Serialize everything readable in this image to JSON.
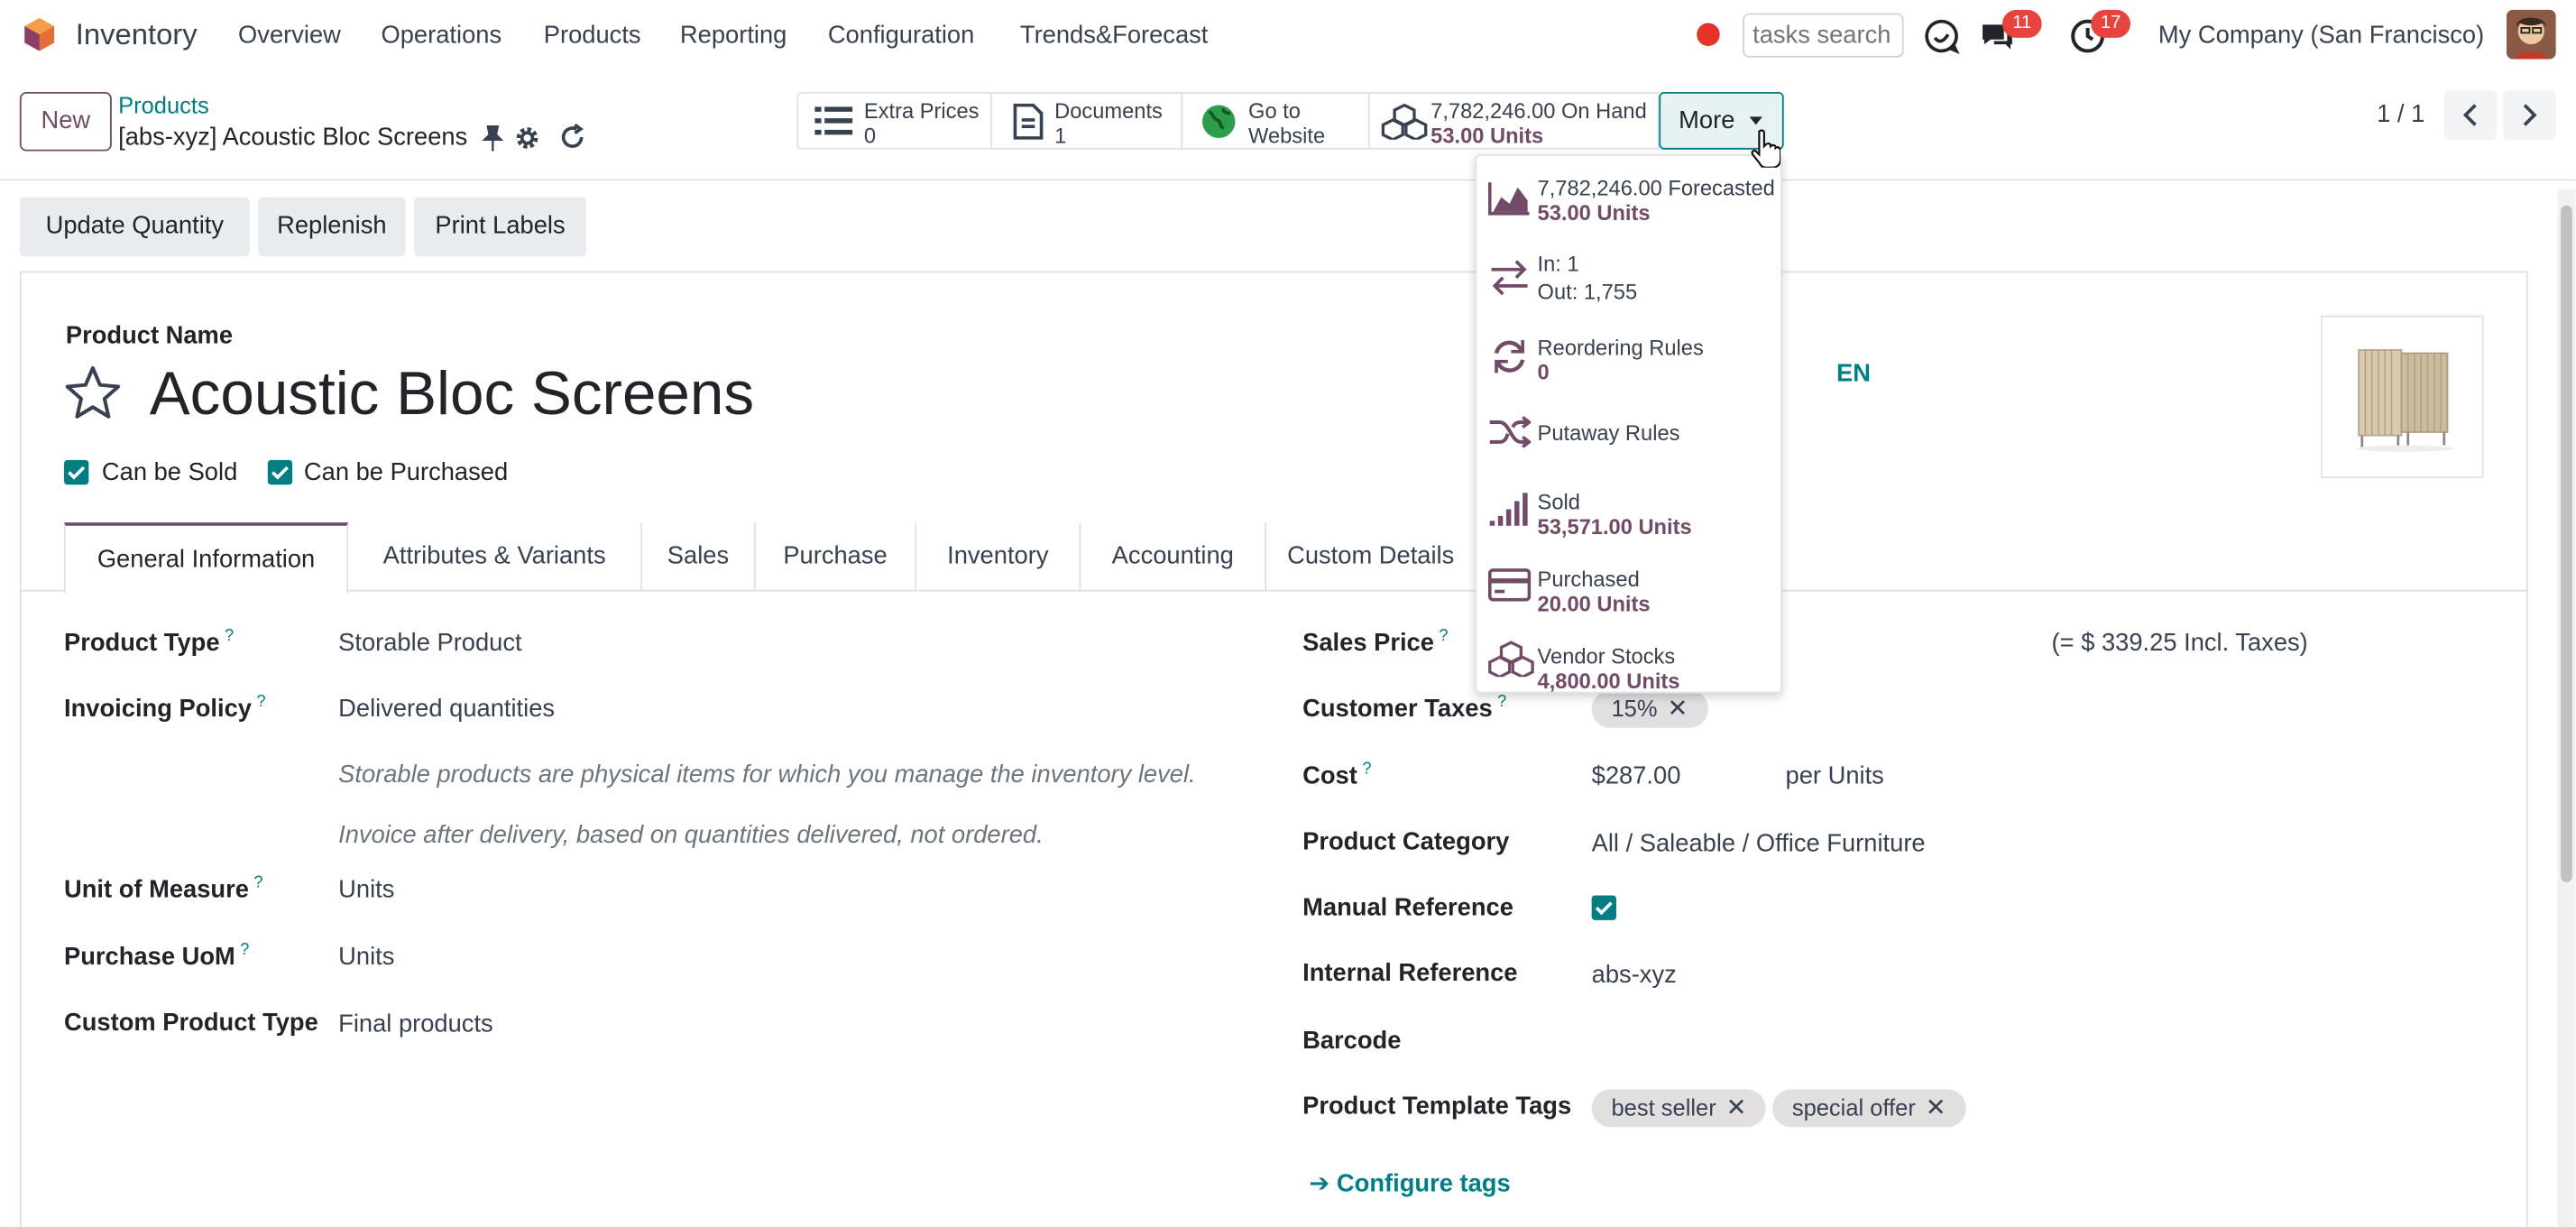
{
  "navbar": {
    "app_name": "Inventory",
    "menu": [
      "Overview",
      "Operations",
      "Products",
      "Reporting",
      "Configuration",
      "Trends&Forecast"
    ],
    "search_placeholder": "tasks search",
    "messages_count": "11",
    "activities_count": "17",
    "company": "My Company (San Francisco)"
  },
  "control": {
    "new_label": "New",
    "breadcrumb_parent": "Products",
    "breadcrumb_current": "[abs-xyz] Acoustic Bloc Screens",
    "smart_buttons": [
      {
        "icon": "list-icon",
        "line1": "Extra Prices",
        "line2": "0"
      },
      {
        "icon": "file-icon",
        "line1": "Documents",
        "line2": "1"
      },
      {
        "icon": "globe-icon",
        "line1": "Go to",
        "line2": "Website"
      },
      {
        "icon": "cubes-icon",
        "line1": "7,782,246.00 On Hand",
        "line2": "53.00 Units"
      }
    ],
    "more_label": "More",
    "pager": "1 / 1"
  },
  "dropdown": {
    "items": [
      {
        "icon": "area-chart-icon",
        "line1": "7,782,246.00 Forecasted",
        "line2": "53.00 Units"
      },
      {
        "icon": "exchange-icon",
        "line1": "In: 1",
        "line2": "Out: 1,755"
      },
      {
        "icon": "refresh-icon",
        "line1": "Reordering Rules",
        "line2": "0"
      },
      {
        "icon": "random-icon",
        "line1": "Putaway Rules",
        "line2": ""
      },
      {
        "icon": "signal-icon",
        "line1": "Sold",
        "line2": "53,571.00 Units"
      },
      {
        "icon": "credit-card-icon",
        "line1": "Purchased",
        "line2": "20.00 Units"
      },
      {
        "icon": "cubes-icon",
        "line1": "Vendor Stocks",
        "line2": "4,800.00 Units"
      }
    ]
  },
  "status_buttons": [
    "Update Quantity",
    "Replenish",
    "Print Labels"
  ],
  "product": {
    "name_label": "Product Name",
    "name": "Acoustic Bloc Screens",
    "lang": "EN",
    "can_be_sold": "Can be Sold",
    "can_be_purchased": "Can be Purchased"
  },
  "tabs": [
    "General Information",
    "Attributes & Variants",
    "Sales",
    "Purchase",
    "Inventory",
    "Accounting",
    "Custom Details"
  ],
  "left_fields": {
    "product_type_label": "Product Type",
    "product_type": "Storable Product",
    "invoicing_policy_label": "Invoicing Policy",
    "invoicing_policy": "Delivered quantities",
    "help1": "Storable products are physical items for which you manage the inventory level.",
    "help2": "Invoice after delivery, based on quantities delivered, not ordered.",
    "uom_label": "Unit of Measure",
    "uom": "Units",
    "purchase_uom_label": "Purchase UoM",
    "purchase_uom": "Units",
    "custom_type_label": "Custom Product Type",
    "custom_type": "Final products"
  },
  "right_fields": {
    "sales_price_label": "Sales Price",
    "sales_price_incl": "(= $ 339.25 Incl. Taxes)",
    "customer_taxes_label": "Customer Taxes",
    "customer_tax_tag": "15%",
    "cost_label": "Cost",
    "cost": "$287.00",
    "cost_unit": "per Units",
    "category_label": "Product Category",
    "category": "All / Saleable / Office Furniture",
    "manual_ref_label": "Manual Reference",
    "internal_ref_label": "Internal Reference",
    "internal_ref": "abs-xyz",
    "barcode_label": "Barcode",
    "tags_label": "Product Template Tags",
    "tags": [
      "best seller",
      "special offer"
    ],
    "configure_tags": "Configure tags"
  },
  "colors": {
    "brand": "#714b67",
    "accent": "#017e84",
    "badge": "#e8433d"
  }
}
